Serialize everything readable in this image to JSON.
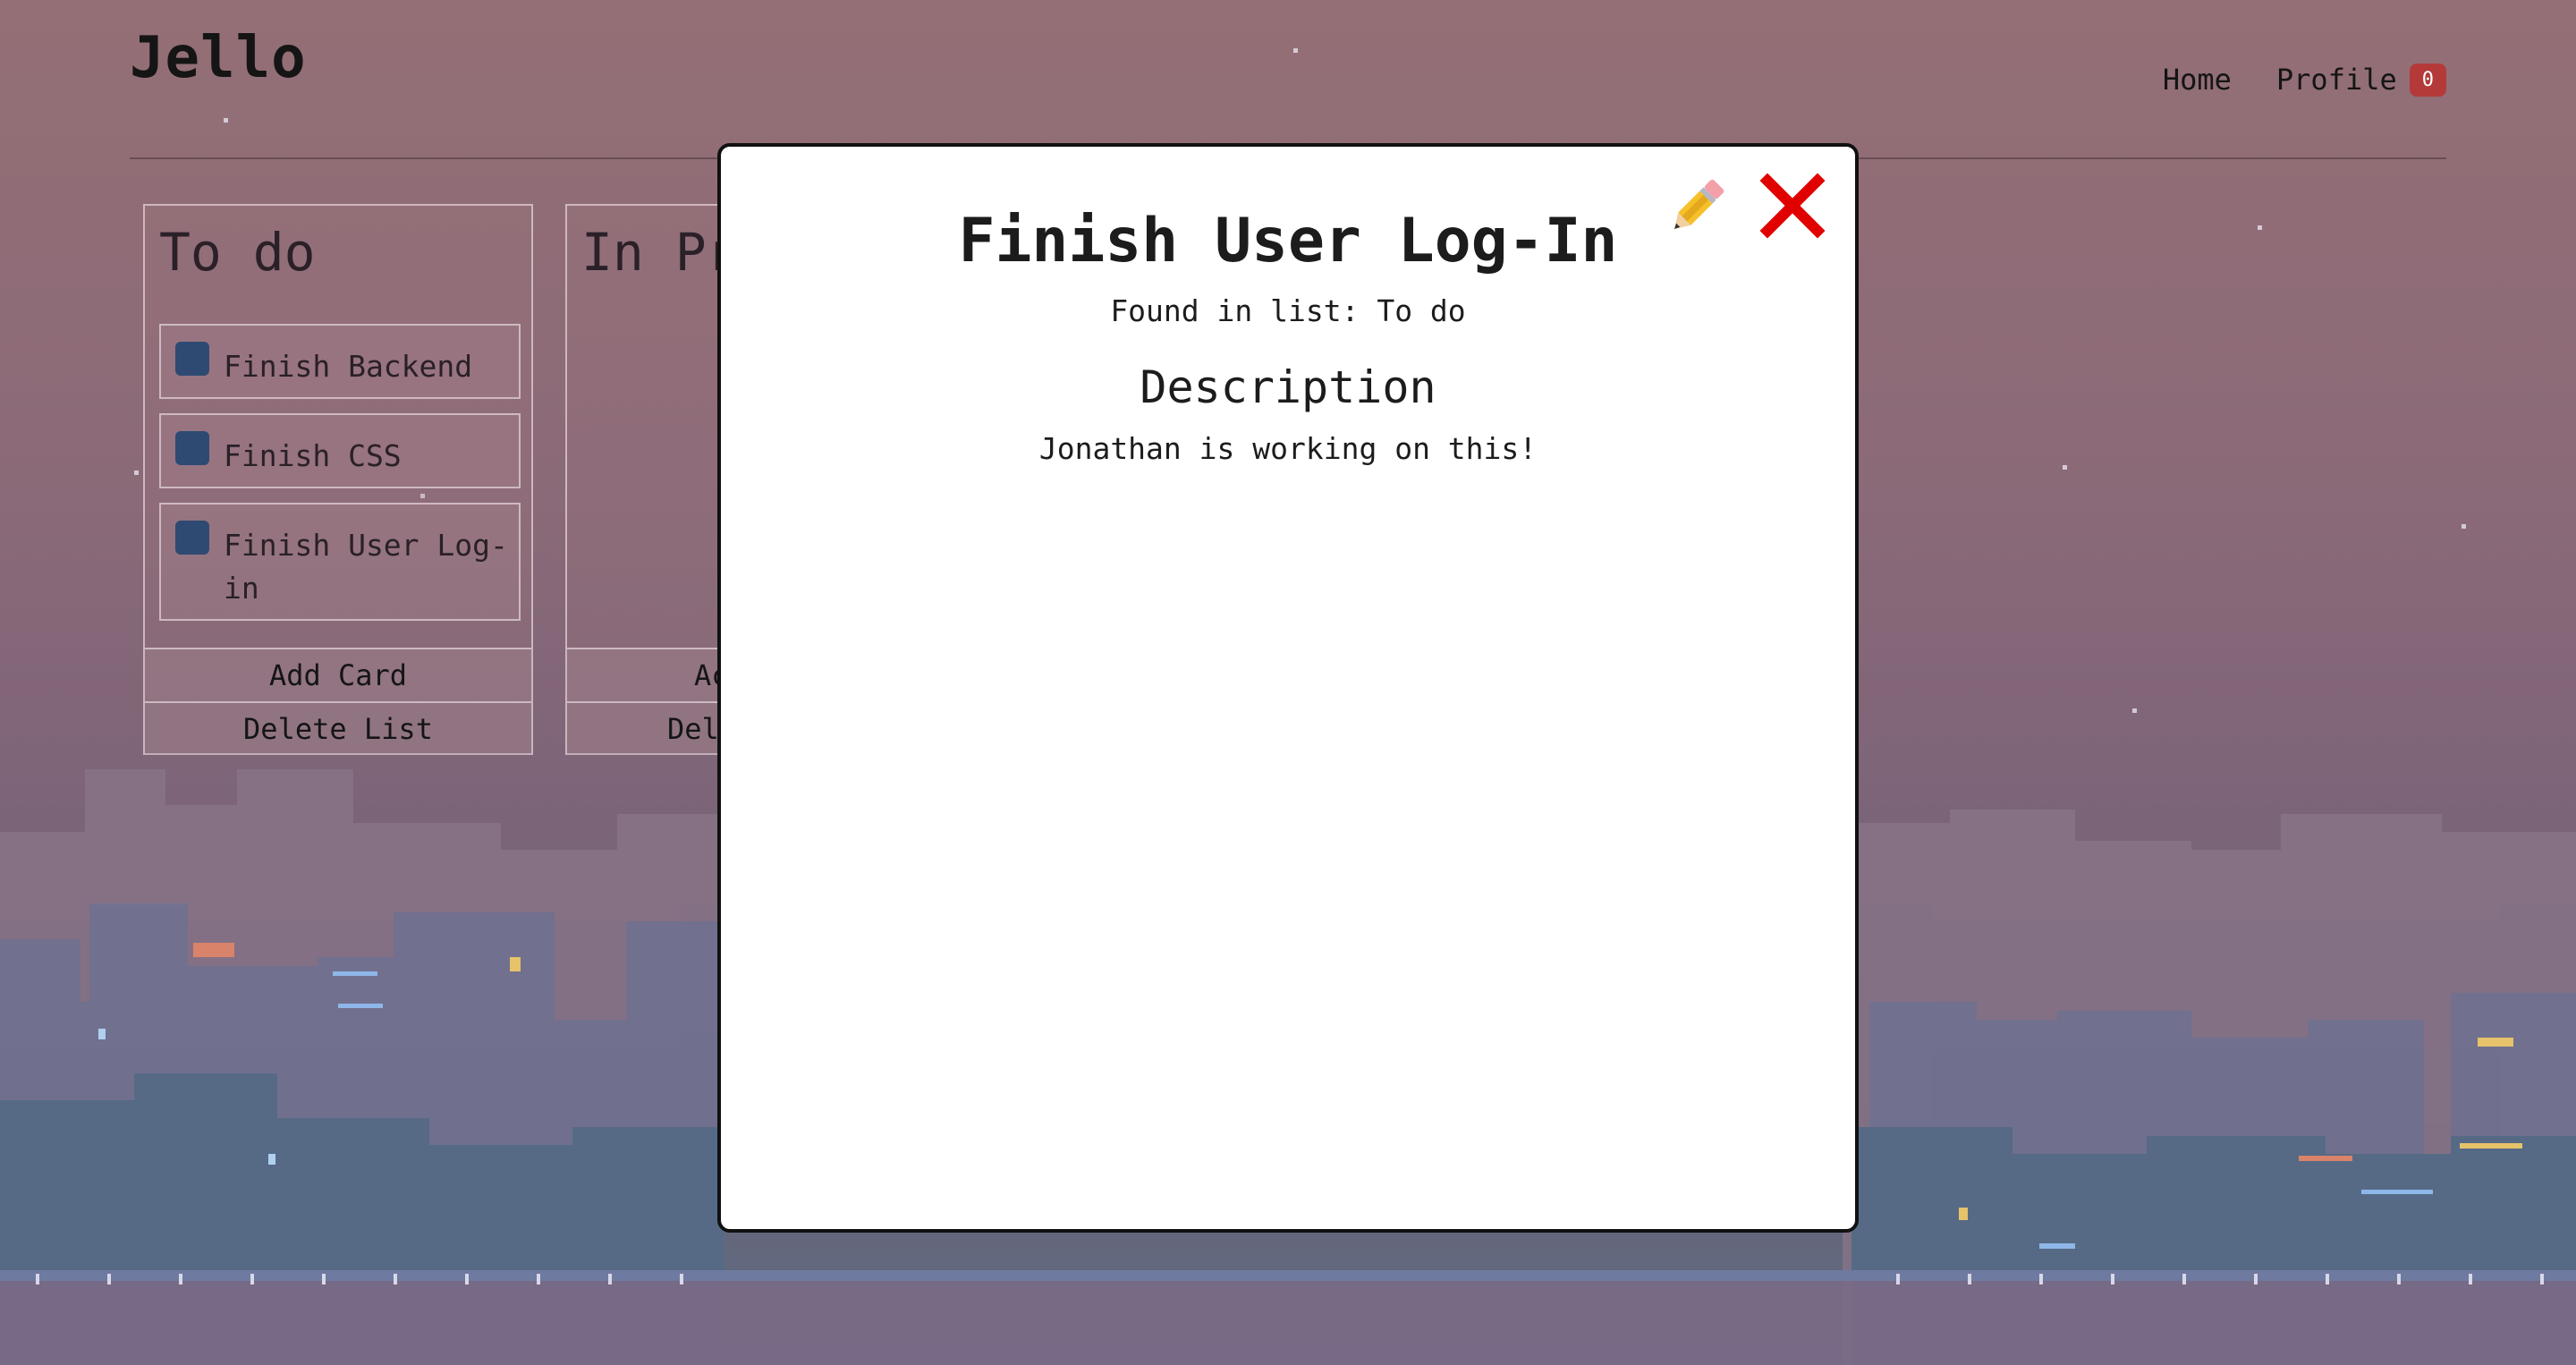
{
  "header": {
    "brand": "Jello",
    "nav": {
      "home": "Home",
      "profile": "Profile",
      "profile_badge": "0"
    }
  },
  "lists": [
    {
      "title": "To do",
      "cards": [
        "Finish Backend",
        "Finish CSS",
        "Finish User Log-in"
      ],
      "add_card": "Add Card",
      "delete_list": "Delete List"
    },
    {
      "title": "In Pr",
      "add_card": "Ac",
      "delete_list": "Del"
    }
  ],
  "modal": {
    "title": "Finish User Log-In",
    "found_in": "Found in list: To do",
    "description_heading": "Description",
    "description": "Jonathan is working on this!",
    "edit_icon": "pencil-icon",
    "close_icon": "close-icon"
  },
  "colors": {
    "badge": "#b43a3a",
    "checkbox": "#2e4a72",
    "close": "#e00000"
  }
}
